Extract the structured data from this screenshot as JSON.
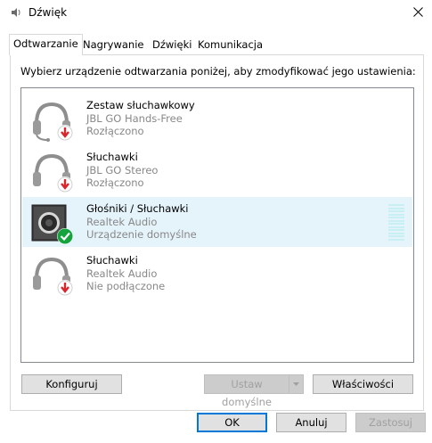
{
  "window": {
    "title": "Dźwięk"
  },
  "tabs": [
    {
      "label": "Odtwarzanie"
    },
    {
      "label": "Nagrywanie"
    },
    {
      "label": "Dźwięki"
    },
    {
      "label": "Komunikacja"
    }
  ],
  "instruction": "Wybierz urządzenie odtwarzania poniżej, aby zmodyfikować jego ustawienia:",
  "devices": [
    {
      "name": "Zestaw słuchawkowy",
      "driver": "JBL GO Hands-Free",
      "status": "Rozłączono",
      "icon": "headset-icon",
      "badge": "disconnected-arrow",
      "selected": false
    },
    {
      "name": "Słuchawki",
      "driver": "JBL GO Stereo",
      "status": "Rozłączono",
      "icon": "headphones-icon",
      "badge": "disconnected-arrow",
      "selected": false
    },
    {
      "name": "Głośniki / Słuchawki",
      "driver": "Realtek Audio",
      "status": "Urządzenie domyślne",
      "icon": "speaker-icon",
      "badge": "default-checkmark",
      "selected": true
    },
    {
      "name": "Słuchawki",
      "driver": "Realtek Audio",
      "status": "Nie podłączone",
      "icon": "headphones-icon",
      "badge": "disconnected-arrow",
      "selected": false
    }
  ],
  "buttons": {
    "configure": "Konfiguruj",
    "set_default": "Ustaw domyślne",
    "properties": "Właściwości",
    "ok": "OK",
    "cancel": "Anuluj",
    "apply": "Zastosuj"
  },
  "colors": {
    "selection": "#e5f3fb",
    "disconnected_badge": "#d9262c",
    "default_badge": "#14a33d",
    "focus_border": "#0078d7"
  }
}
